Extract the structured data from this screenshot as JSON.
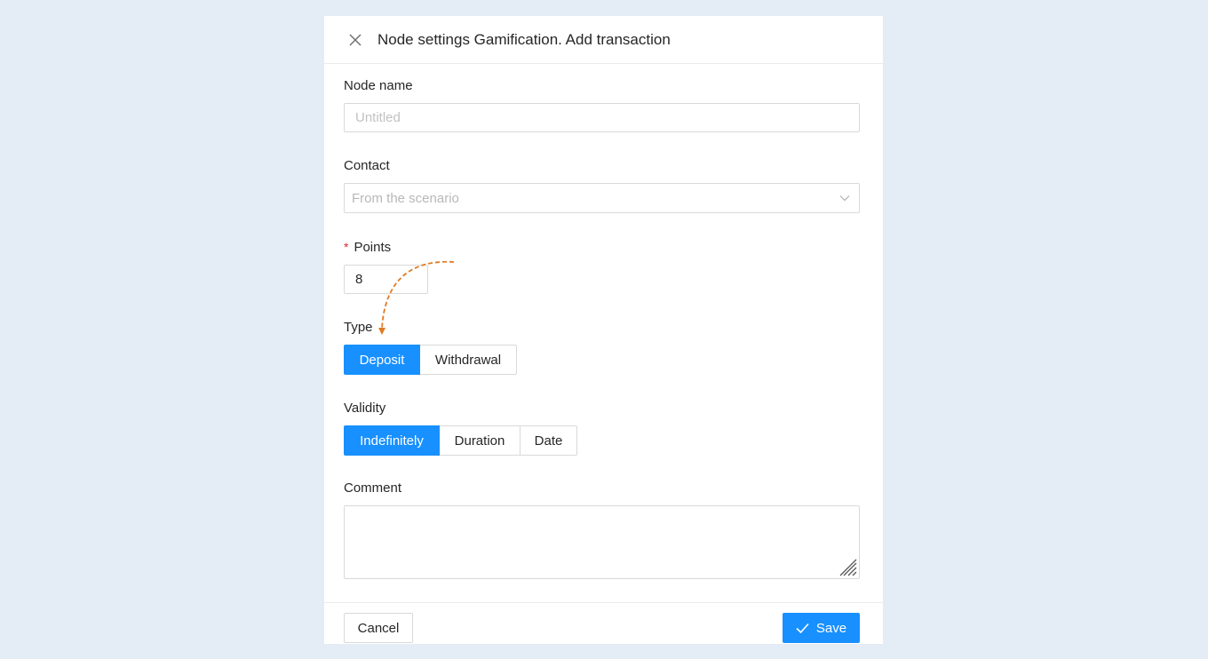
{
  "dialog": {
    "title": "Node settings Gamification. Add transaction"
  },
  "node_name": {
    "label": "Node name",
    "placeholder": "Untitled",
    "value": ""
  },
  "contact": {
    "label": "Contact",
    "placeholder": "From the scenario"
  },
  "points": {
    "required_mark": "*",
    "label": "Points",
    "value": "8"
  },
  "type": {
    "label": "Type",
    "options": [
      "Deposit",
      "Withdrawal"
    ],
    "selected": "Deposit"
  },
  "validity": {
    "label": "Validity",
    "options": [
      "Indefinitely",
      "Duration",
      "Date"
    ],
    "selected": "Indefinitely"
  },
  "comment": {
    "label": "Comment",
    "value": ""
  },
  "footer": {
    "cancel_label": "Cancel",
    "save_label": "Save"
  },
  "colors": {
    "background": "#e4ecf6",
    "primary": "#1890ff",
    "required": "#e0282e",
    "annotation_arrow": "#e07b24"
  },
  "icons": {
    "close": "close-icon",
    "dropdown": "chevron-down-icon",
    "save": "check-icon",
    "resize": "resize-handle-icon"
  }
}
